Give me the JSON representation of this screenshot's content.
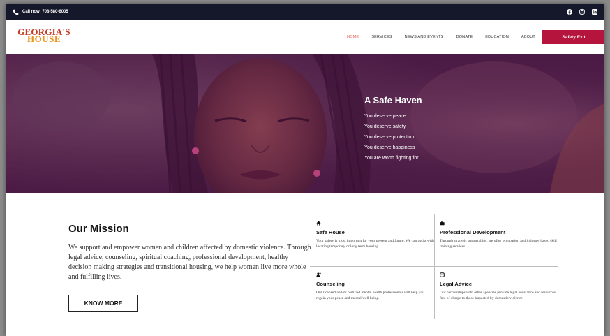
{
  "topbar": {
    "phone": "Call now: 708-580-6005",
    "social_icons": [
      "facebook-icon",
      "instagram-icon",
      "linkedin-icon"
    ]
  },
  "brand": {
    "line1": "GEORGIA'S",
    "line2": "HOUSE"
  },
  "nav": {
    "items": [
      "HOME",
      "SERVICES",
      "NEWS AND EVENTS",
      "DONATE",
      "EDUCATION",
      "ABOUT"
    ],
    "active": "HOME",
    "safety_exit": "Safety Exit"
  },
  "hero": {
    "title": "A Safe Haven",
    "lines": [
      "You deserve peace",
      "You deserve safety",
      "You deserve protection",
      "You deserve happiness",
      "You are worth fighting for"
    ]
  },
  "mission": {
    "title": "Our Mission",
    "body": "We support and empower women and children affected by domestic violence. Through legal advice, counseling, spiritual coaching, professional development, healthy decision making strategies and transitional housing, we help women live more whole and fulfilling lives.",
    "button": "KNOW MORE"
  },
  "services": [
    {
      "icon": "house-icon",
      "title": "Safe House",
      "text": "Your safety is most important for your present and future. We can assist with locating temporary or long term housing."
    },
    {
      "icon": "briefcase-icon",
      "title": "Professional Development",
      "text": "Through strategic partnerships, we offer occupation and industry-based skill training services."
    },
    {
      "icon": "counselor-icon",
      "title": "Counseling",
      "text": "Our licensed and/or certified mental health professionals will help you regain your peace and mental well being."
    },
    {
      "icon": "scales-icon",
      "title": "Legal Advice",
      "text": "Our partnerships with other agencies provide legal assistance and resources free of charge to those impacted by domestic violence."
    }
  ],
  "colors": {
    "topbar": "#15182a",
    "accent": "#b5153c",
    "active_nav": "#e35a4e",
    "logo_red": "#c43a23",
    "logo_orange": "#e89420",
    "hero_tint": "#7a1e6e"
  }
}
